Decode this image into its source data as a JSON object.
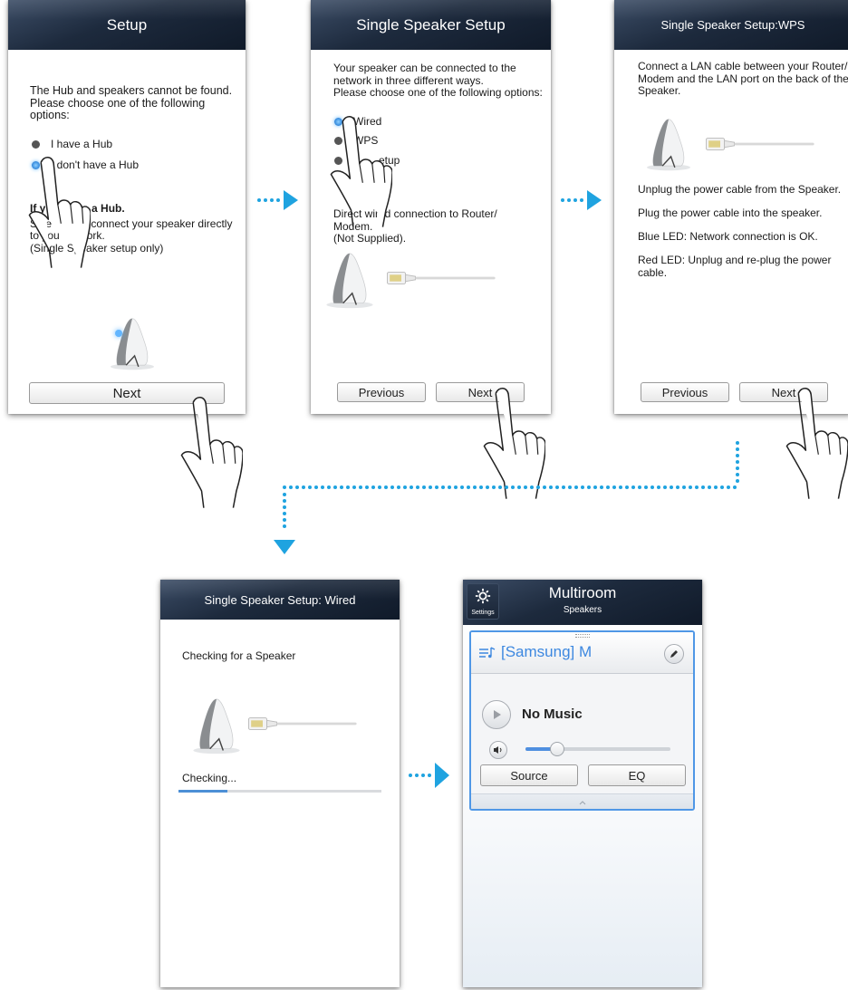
{
  "screens": {
    "setup": {
      "title": "Setup",
      "message_lines": [
        "The Hub and speakers cannot be found.",
        "Please choose one of the following",
        "options:"
      ],
      "options": [
        "I have a Hub",
        "I don't have a Hub"
      ],
      "selected_option": "I don't have a Hub",
      "hint_title": "If y      have a Hub.",
      "hint_lines": [
        "Sele          o connect your speaker directly",
        "to you         ork.",
        "(Single Speaker setup only)"
      ],
      "next_label": "Next"
    },
    "single": {
      "title": "Single Speaker Setup",
      "message_lines": [
        "Your speaker can be connected to the",
        "network in three different ways.",
        "Please choose one of the following options:"
      ],
      "options": [
        "Wired",
        "WPS",
        "etup"
      ],
      "selected_option": "Wired",
      "description_lines": [
        "Direct wired connection to Router/",
        "Modem.",
        "(Not Supplied)."
      ],
      "previous_label": "Previous",
      "next_label": "Next"
    },
    "wps": {
      "title": "Single Speaker Setup:WPS",
      "intro_lines": [
        "Connect a LAN cable between your Router/",
        "Modem and the LAN port on the back of the",
        "Speaker."
      ],
      "step1": "Unplug the power cable from the Speaker.",
      "step2": "Plug the power cable into the speaker.",
      "step3": "Blue LED: Network connection is OK.",
      "step4_lines": [
        "Red LED: Unplug and re-plug the power",
        "cable."
      ],
      "previous_label": "Previous",
      "next_label": "Next"
    },
    "wired": {
      "title": "Single Speaker Setup: Wired",
      "checking_speaker": "Checking for a Speaker",
      "status": "Checking...",
      "progress": 0.24
    },
    "multiroom": {
      "settings_label": "Settings",
      "title": "Multiroom",
      "subtitle": "Speakers",
      "speaker_name": "[Samsung] M",
      "now_playing": "No Music",
      "volume": 0.22,
      "source_label": "Source",
      "eq_label": "EQ"
    }
  },
  "colors": {
    "accent_blue": "#1fa3e0",
    "title_bar": "#1d2a3d",
    "selection_blue": "#4f97e6"
  },
  "icons": [
    "hand-pointer-icon",
    "arrow-right-icon",
    "arrow-down-icon",
    "gear-icon",
    "music-list-icon",
    "pencil-icon",
    "play-icon",
    "volume-icon",
    "chevron-up-icon"
  ]
}
